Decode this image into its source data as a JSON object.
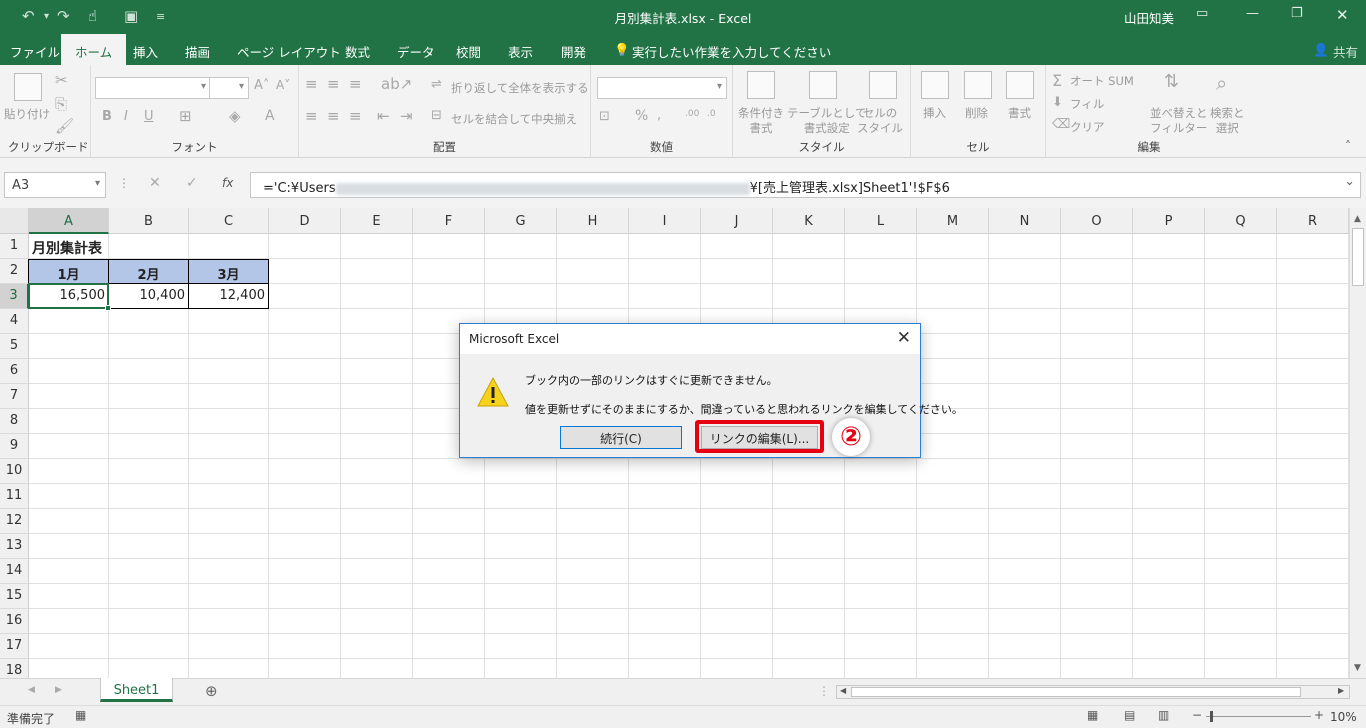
{
  "window": {
    "title": "月別集計表.xlsx  -  Excel",
    "user": "山田知美",
    "share_label": "共有"
  },
  "qat": {
    "undo_icon": "undo-icon",
    "redo_icon": "redo-icon",
    "touch_icon": "touch-mode-icon",
    "save_icon": "save-icon"
  },
  "tabs": [
    "ファイル",
    "ホーム",
    "挿入",
    "描画",
    "ページ レイアウト",
    "数式",
    "データ",
    "校閲",
    "表示",
    "開発"
  ],
  "active_tab": "ホーム",
  "tell_me": "実行したい作業を入力してください",
  "ribbon": {
    "clipboard": {
      "paste": "貼り付け",
      "label": "クリップボード"
    },
    "font": {
      "label": "フォント"
    },
    "alignment": {
      "wrap": "折り返して全体を表示する",
      "merge": "セルを結合して中央揃え",
      "label": "配置"
    },
    "number": {
      "label": "数値"
    },
    "styles": {
      "conditional": "条件付き\n書式",
      "table": "テーブルとして\n書式設定",
      "cell_style": "セルの\nスタイル",
      "label": "スタイル"
    },
    "cells": {
      "insert": "挿入",
      "delete": "削除",
      "format": "書式",
      "label": "セル"
    },
    "editing": {
      "autosum": "オート SUM",
      "fill": "フィル",
      "clear": "クリア",
      "sort": "並べ替えと\nフィルター",
      "find": "検索と\n選択",
      "label": "編集"
    }
  },
  "formula_bar": {
    "name_box": "A3",
    "fx": "fx",
    "formula_prefix": "='C:¥Users",
    "formula_suffix": "¥[売上管理表.xlsx]Sheet1'!$F$6"
  },
  "columns": [
    "A",
    "B",
    "C",
    "D",
    "E",
    "F",
    "G",
    "H",
    "I",
    "J",
    "K",
    "L",
    "M",
    "N",
    "O",
    "P",
    "Q",
    "R"
  ],
  "rows": [
    "1",
    "2",
    "3",
    "4",
    "5",
    "6",
    "7",
    "8",
    "9",
    "10",
    "11",
    "12",
    "13",
    "14",
    "15",
    "16",
    "17",
    "18"
  ],
  "cells": {
    "A1": "月別集計表",
    "A2": "1月",
    "B2": "2月",
    "C2": "3月",
    "A3": "16,500",
    "B3": "10,400",
    "C3": "12,400"
  },
  "header_fill": "#b4c6e7",
  "sheet_tab": "Sheet1",
  "status": {
    "ready": "準備完了",
    "zoom": "10%"
  },
  "dialog": {
    "title": "Microsoft Excel",
    "line1": "ブック内の一部のリンクはすぐに更新できません。",
    "line2": "値を更新せずにそのままにするか、間違っていると思われるリンクを編集してください。",
    "continue": "続行(C)",
    "edit_links": "リンクの編集(L)...",
    "step_marker": "②"
  }
}
